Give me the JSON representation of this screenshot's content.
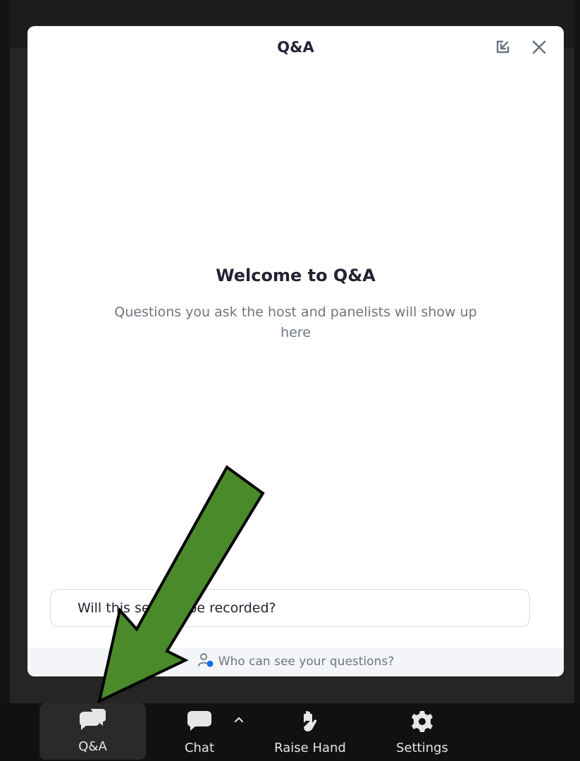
{
  "panel": {
    "title": "Q&A",
    "welcome_title": "Welcome to Q&A",
    "welcome_desc": "Questions you ask the host and panelists will show up here",
    "input_value": "Will this session be recorded?",
    "who_can_see": "Who can see your questions?"
  },
  "toolbar": {
    "qa_label": "Q&A",
    "chat_label": "Chat",
    "raise_label": "Raise Hand",
    "settings_label": "Settings"
  },
  "colors": {
    "accent_blue": "#0e72ed",
    "annotation_arrow": "#4a8a2a"
  }
}
